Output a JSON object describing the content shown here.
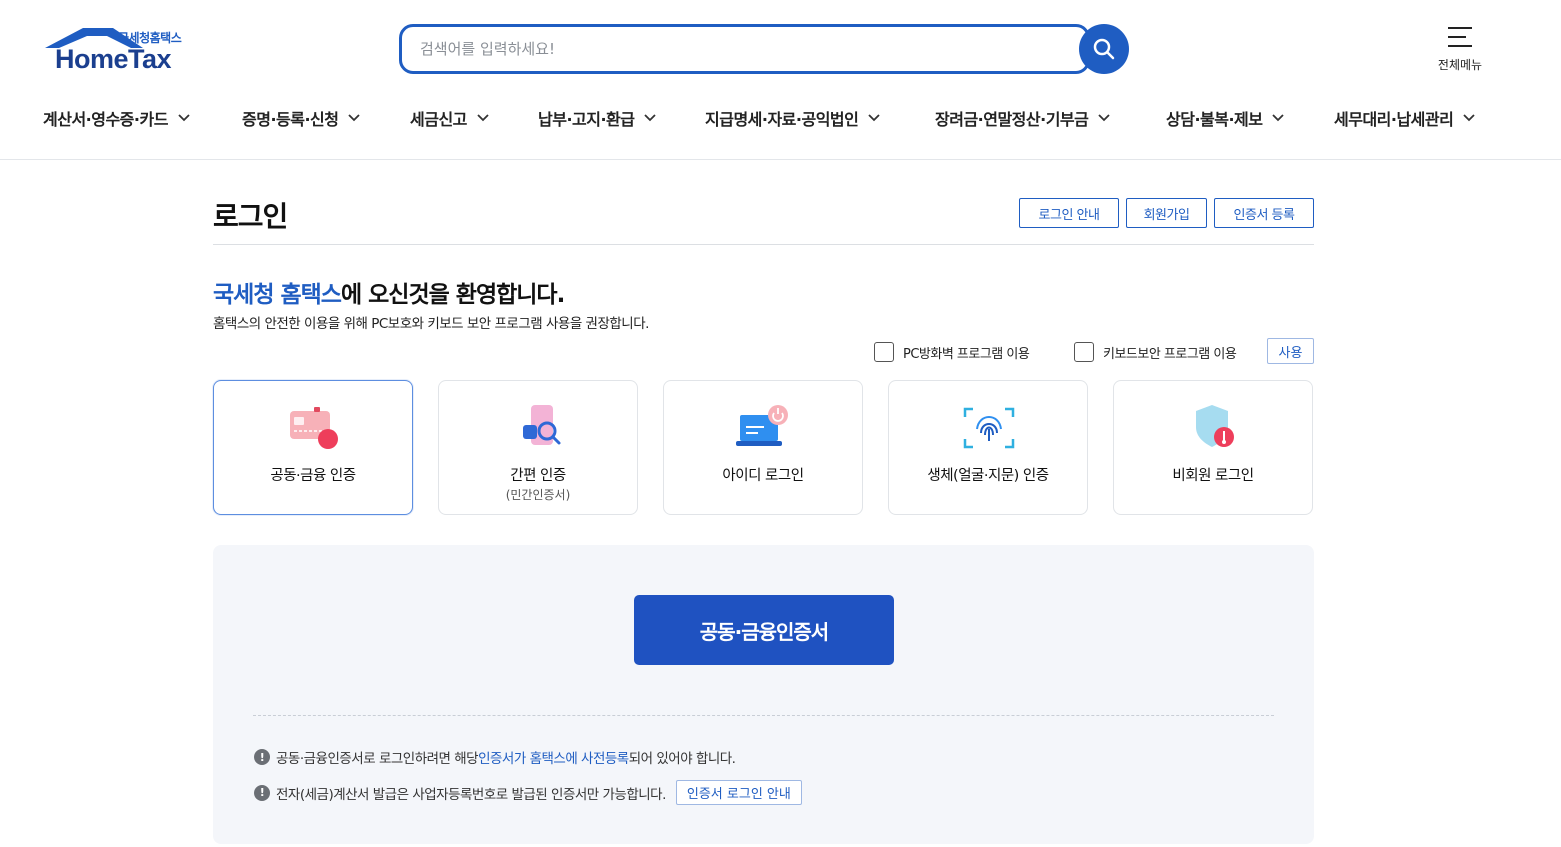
{
  "header": {
    "logo_sub": "국세청홈택스",
    "logo_main": "HomeTax",
    "search_placeholder": "검색어를 입력하세요!",
    "all_menu_label": "전체메뉴",
    "nav": [
      "계산서·영수증·카드",
      "증명·등록·신청",
      "세금신고",
      "납부·고지·환급",
      "지급명세·자료·공익법인",
      "장려금·연말정산·기부금",
      "상담·불복·제보",
      "세무대리·납세관리"
    ]
  },
  "main": {
    "title": "로그인",
    "title_buttons": {
      "login_guide": "로그인 안내",
      "signup": "회원가입",
      "cert_register": "인증서 등록"
    },
    "welcome_highlight": "국세청 홈택스",
    "welcome_rest": "에 오신것을 환영합니다.",
    "welcome_sub": "홈택스의 안전한 이용을 위해 PC보호와 키보드 보안 프로그램 사용을 권장합니다.",
    "options": {
      "pc_firewall": "PC방화벽 프로그램 이용",
      "keyboard_security": "키보드보안 프로그램 이용",
      "use_button": "사용"
    },
    "login_methods": [
      {
        "label": "공동·금융 인증",
        "sub": ""
      },
      {
        "label": "간편 인증",
        "sub": "(민간인증서)"
      },
      {
        "label": "아이디 로그인",
        "sub": ""
      },
      {
        "label": "생체(얼굴·지문) 인증",
        "sub": ""
      },
      {
        "label": "비회원 로그인",
        "sub": ""
      }
    ],
    "cert_button": "공동·금융인증서",
    "notice1": {
      "before": "공동·금융인증서로 로그인하려면 해당 ",
      "link": "인증서가 홈택스에 사전등록",
      "after": "되어 있어야 합니다."
    },
    "notice2": {
      "text": "전자(세금)계산서 발급은 사업자등록번호로 발급된 인증서만 가능합니다.",
      "button": "인증서 로그인 안내"
    }
  },
  "colors": {
    "primary": "#1f5dc2",
    "primary_dark": "#1f52c1",
    "logo_navy": "#1b3f8f",
    "panel_bg": "#f4f6fa"
  }
}
